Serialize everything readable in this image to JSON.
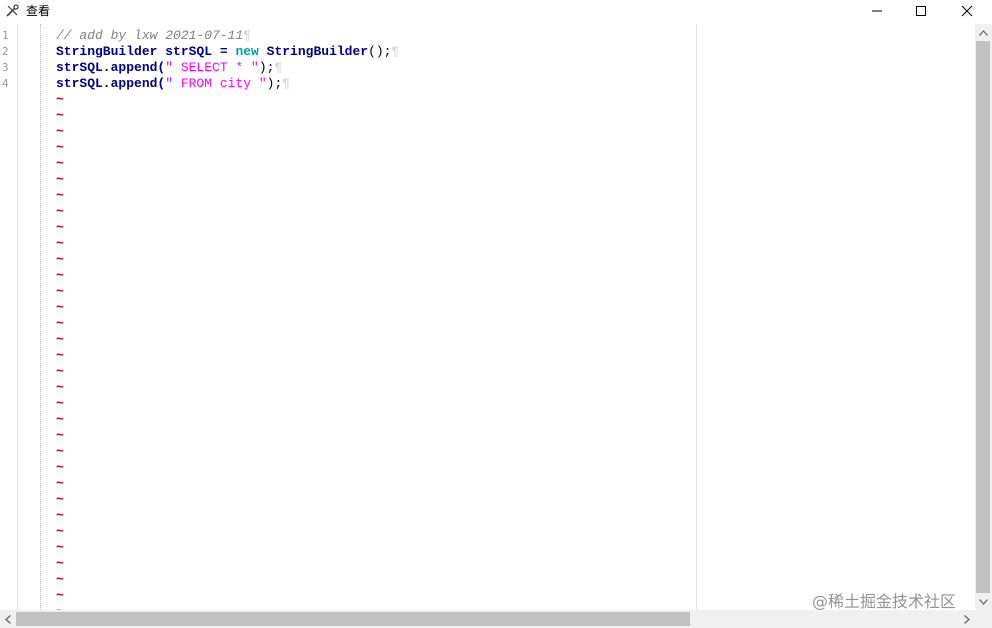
{
  "window": {
    "title": "查看",
    "icon": "tools-icon"
  },
  "editor": {
    "line_numbers": [
      "1",
      "2",
      "3",
      "4"
    ],
    "code_lines": [
      [
        {
          "t": "// add by lxw 2021-07-11",
          "c": "cm"
        },
        {
          "t": "¶",
          "c": "eol"
        }
      ],
      [
        {
          "t": "StringBuilder strSQL = ",
          "c": "cls"
        },
        {
          "t": "new",
          "c": "kw"
        },
        {
          "t": " ",
          "c": ""
        },
        {
          "t": "StringBuilder",
          "c": "cls"
        },
        {
          "t": "();",
          "c": ""
        },
        {
          "t": "¶",
          "c": "eol"
        }
      ],
      [
        {
          "t": "strSQL.append(",
          "c": "fn"
        },
        {
          "t": "\" SELECT * \"",
          "c": "str"
        },
        {
          "t": ");",
          "c": ""
        },
        {
          "t": "¶",
          "c": "eol"
        }
      ],
      [
        {
          "t": "strSQL.append(",
          "c": "fn"
        },
        {
          "t": "\" FROM city \"",
          "c": "str"
        },
        {
          "t": ");",
          "c": ""
        },
        {
          "t": "¶",
          "c": "eol"
        }
      ]
    ],
    "empty_line_marker": "~",
    "empty_line_count": 33
  },
  "watermark": "@稀土掘金技术社区"
}
